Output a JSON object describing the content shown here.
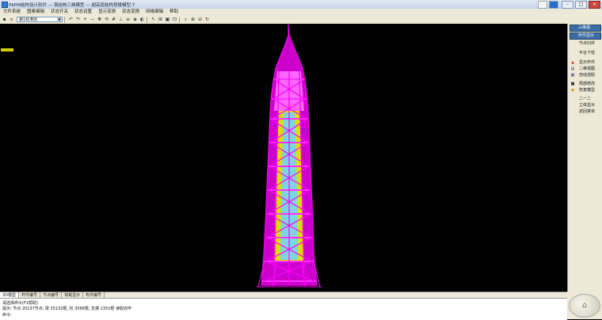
{
  "window": {
    "title": "PKPM结构设计软件 — 钢结构三维模型 — 超高层结构塔楼模型.T",
    "buttons": [
      "–",
      "□",
      "×"
    ]
  },
  "menu": [
    "文件系统",
    "图素编辑",
    "状态开关",
    "状态设置",
    "显示变换",
    "状态变换",
    "网格编辑",
    "帮助"
  ],
  "toolbar": {
    "selector_value": "第1标准层",
    "icons": [
      "save-icon",
      "undo-icon",
      "redo-icon",
      "zoom-in-icon",
      "zoom-out-icon",
      "pan-icon",
      "rotate-icon",
      "grid-icon",
      "axis-icon",
      "layer-icon",
      "view-3d-icon",
      "color-icon",
      "print-icon"
    ]
  },
  "right_panel": {
    "items": [
      {
        "label": "三维视",
        "highlight": true,
        "icon": ""
      },
      {
        "label": "杆件显示",
        "highlight": true,
        "icon": ""
      },
      {
        "label": "节点归并",
        "highlight": false,
        "icon": ""
      },
      {
        "label": "平台下柱",
        "highlight": false,
        "icon": ""
      },
      {
        "label": "显示杆件",
        "highlight": false,
        "icon": "▲"
      },
      {
        "label": "二维视图",
        "highlight": false,
        "icon": "▤"
      },
      {
        "label": "自动选取",
        "highlight": false,
        "icon": "▦"
      },
      {
        "label": "局部修改",
        "highlight": false,
        "icon": "■"
      },
      {
        "label": "恢复模型",
        "highlight": false,
        "icon": "◆"
      },
      {
        "label": "二一二",
        "highlight": false,
        "icon": ""
      },
      {
        "label": "立体显示",
        "highlight": false,
        "icon": ""
      },
      {
        "label": "返回菜单",
        "highlight": false,
        "icon": ""
      }
    ]
  },
  "tabs": [
    "3D模型",
    "杆件编号",
    "节点编号",
    "荷载显示",
    "构件编号"
  ],
  "command": {
    "prompt_label": "请选择命令(F1帮助)",
    "line1": "提示: 节点 20137节点, 梁 35132根, 柱 3068根, 支撑 2351根 读取完毕",
    "line2": "命令:"
  },
  "colors": {
    "background": "#000000",
    "structure_magenta": "#ff00ff",
    "structure_yellow": "#e6e600",
    "structure_cyan": "#66d0e0",
    "indicator_yellow": "#d4d000"
  }
}
